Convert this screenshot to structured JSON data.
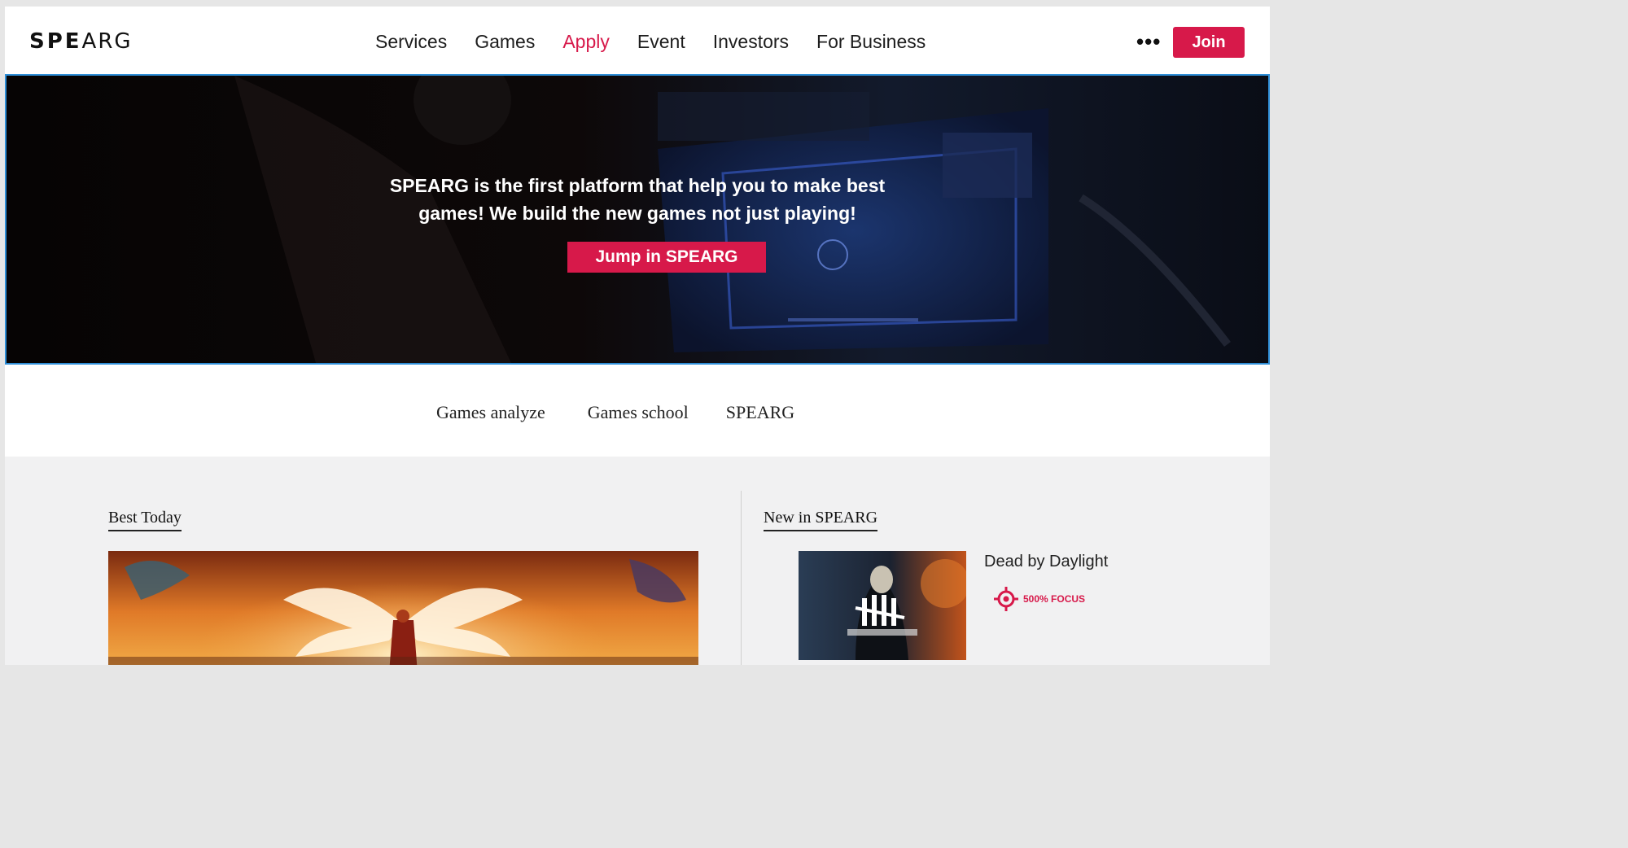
{
  "header": {
    "logo_bold": "SPE",
    "logo_thin": "ARG",
    "nav": [
      "Services",
      "Games",
      "Apply",
      "Event",
      "Investors",
      "For Business"
    ],
    "active_nav": "Apply",
    "more_label": "•••",
    "join_label": "Join"
  },
  "hero": {
    "line1": "SPEARG is the  first platform that help you to make best",
    "line2": "games! We build the new games not just playing!",
    "cta_label": "Jump in SPEARG"
  },
  "subnav": [
    "Games analyze",
    "Games school",
    "SPEARG"
  ],
  "best_today": {
    "title": "Best Today"
  },
  "new_in": {
    "title": "New in SPEARG",
    "game_title": "Dead by Daylight",
    "focus_label": "500% FOCUS"
  },
  "colors": {
    "accent": "#d7194a",
    "hero_border": "#2f8fd8"
  },
  "icons": {
    "focus": "target-icon",
    "more": "more-dots-icon"
  }
}
